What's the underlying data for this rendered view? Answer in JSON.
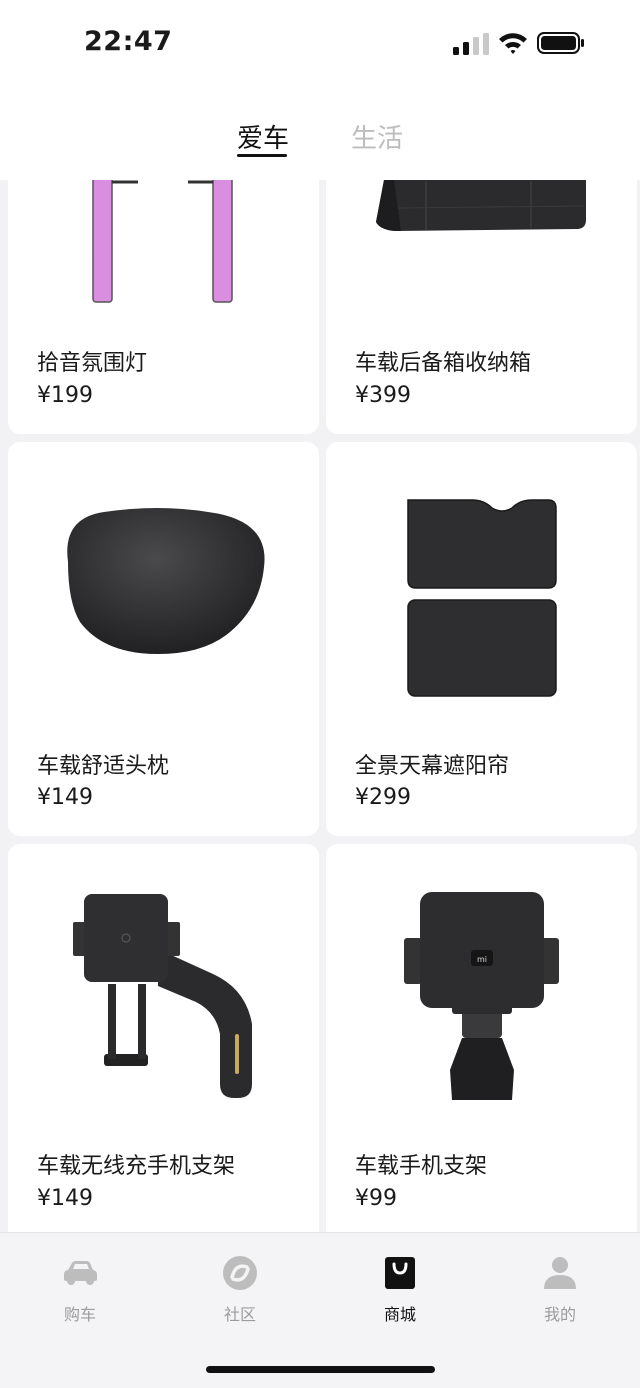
{
  "status_bar": {
    "time": "22:47"
  },
  "tabs": [
    {
      "label": "爱车",
      "active": true
    },
    {
      "label": "生活",
      "active": false
    }
  ],
  "products": [
    {
      "name": "拾音氛围灯",
      "price": "¥199",
      "image": "ambient-light-icon"
    },
    {
      "name": "车载后备箱收纳箱",
      "price": "¥399",
      "image": "trunk-storage-box-icon"
    },
    {
      "name": "车载舒适头枕",
      "price": "¥149",
      "image": "headrest-pillow-icon"
    },
    {
      "name": "全景天幕遮阳帘",
      "price": "¥299",
      "image": "sunshade-icon"
    },
    {
      "name": "车载无线充手机支架",
      "price": "¥149",
      "image": "wireless-charging-mount-icon"
    },
    {
      "name": "车载手机支架",
      "price": "¥99",
      "image": "phone-mount-icon"
    }
  ],
  "bottom_nav": [
    {
      "label": "购车",
      "icon": "car-icon",
      "active": false
    },
    {
      "label": "社区",
      "icon": "community-icon",
      "active": false
    },
    {
      "label": "商城",
      "icon": "shopping-bag-icon",
      "active": true
    },
    {
      "label": "我的",
      "icon": "profile-icon",
      "active": false
    }
  ],
  "colors": {
    "accent": "#111111",
    "inactive": "#9b9b9b",
    "background": "#f2f2f4"
  }
}
